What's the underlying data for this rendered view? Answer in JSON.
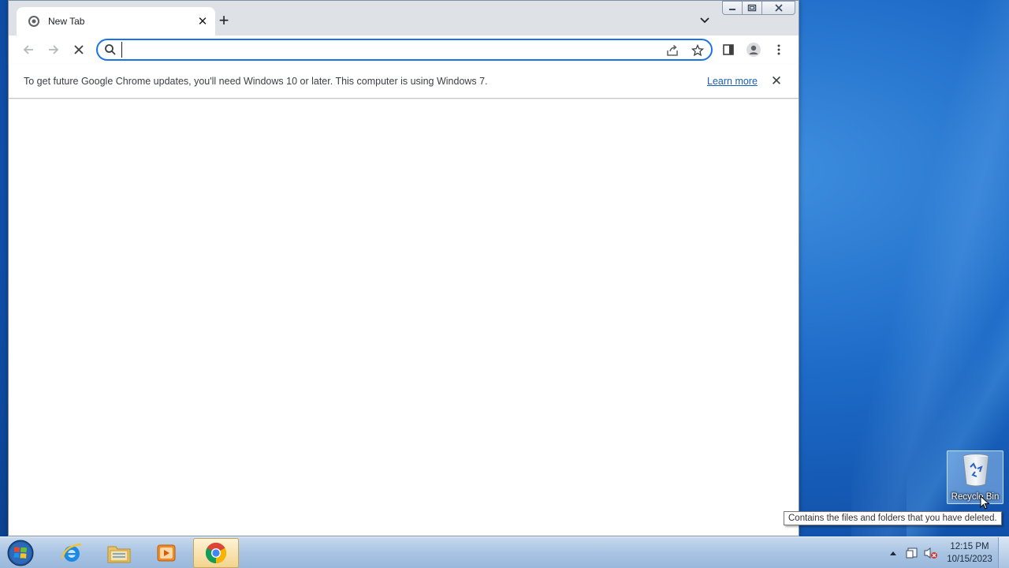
{
  "browser": {
    "tab": {
      "title": "New Tab",
      "close_symbol": "✕"
    },
    "new_tab_symbol": "+",
    "omnibox": {
      "value": "",
      "placeholder": ""
    },
    "infobar": {
      "message": "To get future Google Chrome updates, you'll need Windows 10 or later. This computer is using Windows 7.",
      "link": "Learn more",
      "close_symbol": "✕"
    },
    "accent_color": "#1a73e8"
  },
  "desktop": {
    "recycle_bin": {
      "label": "Recycle Bin",
      "tooltip": "Contains the files and folders that you have deleted."
    }
  },
  "taskbar": {
    "apps": [
      "start-orb-icon",
      "internet-explorer-icon",
      "file-explorer-icon",
      "media-player-icon",
      "chrome-icon"
    ],
    "active_app": "chrome",
    "clock": {
      "time": "12:15 PM",
      "date": "10/15/2023"
    }
  }
}
